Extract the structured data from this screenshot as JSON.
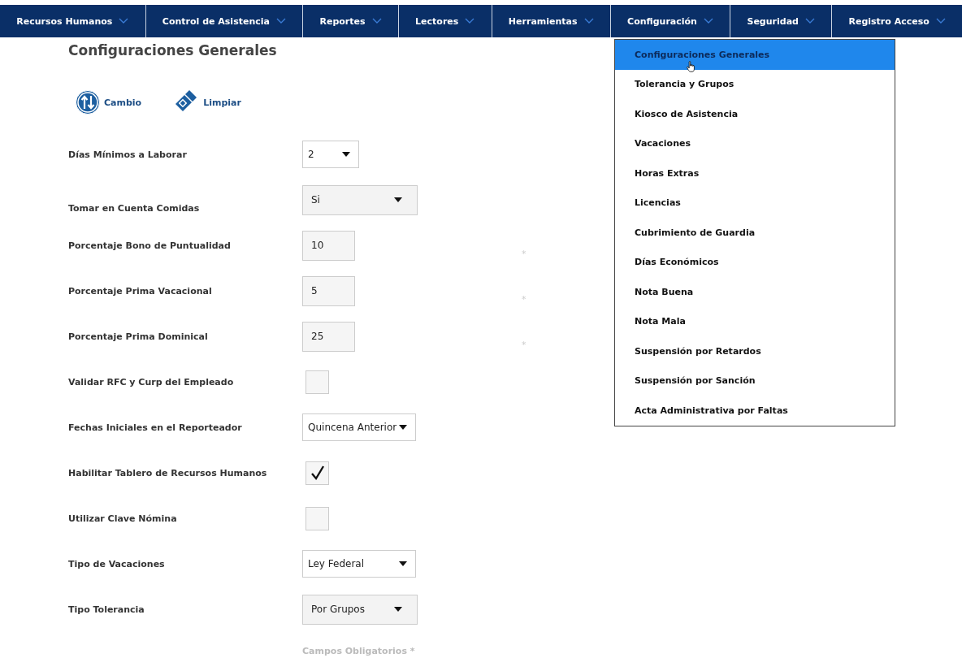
{
  "nav": [
    {
      "label": "Recursos Humanos"
    },
    {
      "label": "Control de Asistencia"
    },
    {
      "label": "Reportes"
    },
    {
      "label": "Lectores"
    },
    {
      "label": "Herramientas"
    },
    {
      "label": "Configuración"
    },
    {
      "label": "Seguridad"
    },
    {
      "label": "Registro Acceso"
    }
  ],
  "dropdown": [
    {
      "label": "Configuraciones Generales",
      "selected": true
    },
    {
      "label": "Tolerancia y Grupos",
      "selected": false
    },
    {
      "label": "Kiosco de Asistencia",
      "selected": false
    },
    {
      "label": "Vacaciones",
      "selected": false
    },
    {
      "label": "Horas Extras",
      "selected": false
    },
    {
      "label": "Licencias",
      "selected": false
    },
    {
      "label": "Cubrimiento de Guardia",
      "selected": false
    },
    {
      "label": "Días Económicos",
      "selected": false
    },
    {
      "label": "Nota Buena",
      "selected": false
    },
    {
      "label": "Nota Mala",
      "selected": false
    },
    {
      "label": "Suspensión por Retardos",
      "selected": false
    },
    {
      "label": "Suspensión por Sanción",
      "selected": false
    },
    {
      "label": "Acta Administrativa por Faltas",
      "selected": false
    }
  ],
  "title": "Configuraciones Generales",
  "actions": [
    {
      "kind": "swap",
      "label": "Cambio"
    },
    {
      "kind": "eraser",
      "label": "Limpiar"
    }
  ],
  "fields": [
    {
      "label": "Días Mínimos a Laborar",
      "kind": "small-select",
      "value": "2"
    },
    {
      "label": "Tomar en Cuenta Comidas",
      "kind": "grey-select",
      "value": "Si"
    },
    {
      "label": "Porcentaje Bono de Puntualidad",
      "kind": "text",
      "value": "10",
      "marker": "*"
    },
    {
      "label": "Porcentaje Prima Vacacional",
      "kind": "text",
      "value": "5",
      "marker": "*"
    },
    {
      "label": "Porcentaje Prima Dominical",
      "kind": "text",
      "value": "25",
      "marker": "*"
    },
    {
      "label": "Validar RFC y Curp del Empleado",
      "kind": "checkbox",
      "checked": false
    },
    {
      "label": "Fechas Iniciales en el Reporteador",
      "kind": "select",
      "value": "Quincena Anterior"
    },
    {
      "label": "Habilitar Tablero de Recursos Humanos",
      "kind": "checkbox",
      "checked": true
    },
    {
      "label": "Utilizar Clave Nómina",
      "kind": "checkbox",
      "checked": false
    },
    {
      "label": "Tipo de Vacaciones",
      "kind": "select",
      "value": "Ley Federal"
    },
    {
      "label": "Tipo Tolerancia",
      "kind": "grey-select",
      "value": "Por Grupos"
    }
  ],
  "footer": "Campos Obligatorios *"
}
